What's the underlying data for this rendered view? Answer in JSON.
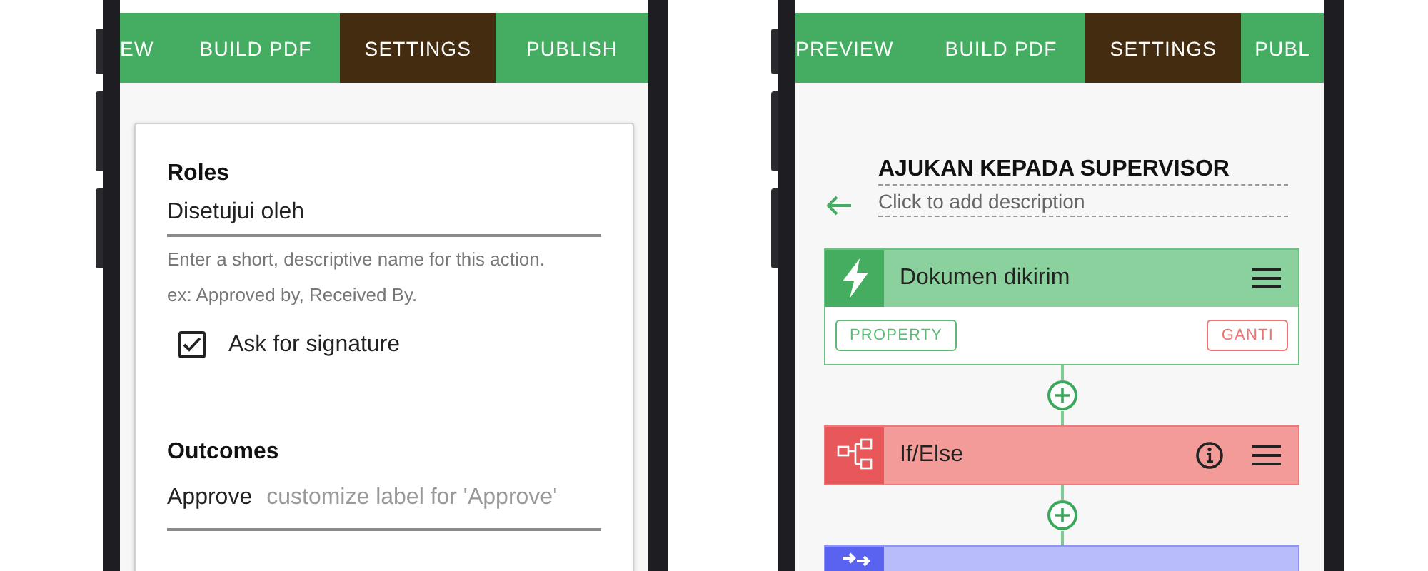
{
  "phones": [
    {
      "kind": "settings",
      "tabs": [
        {
          "label": "EW",
          "selected": false
        },
        {
          "label": "BUILD PDF",
          "selected": false
        },
        {
          "label": "SETTINGS",
          "selected": true
        },
        {
          "label": "PUBLISH",
          "selected": false
        }
      ],
      "roles": {
        "heading": "Roles",
        "value": "Disetujui oleh",
        "help": [
          "Enter a short, descriptive name for this action.",
          "ex: Approved by, Received By."
        ],
        "signature": {
          "label": "Ask for signature",
          "checked": true
        }
      },
      "outcomes": {
        "heading": "Outcomes",
        "items": [
          {
            "label": "Approve",
            "placeholder": "customize label for 'Approve'"
          }
        ]
      }
    },
    {
      "kind": "workflow",
      "tabs": [
        {
          "label": "PREVIEW",
          "selected": false
        },
        {
          "label": "BUILD PDF",
          "selected": false
        },
        {
          "label": "SETTINGS",
          "selected": true
        },
        {
          "label": "PUBL",
          "selected": false
        }
      ],
      "title": "AJUKAN KEPADA SUPERVISOR",
      "description": "Click to add description",
      "blocks": [
        {
          "kind": "trigger",
          "title": "Dokumen dikirim",
          "info": false,
          "buttons": [
            {
              "label": "PROPERTY",
              "kind": "neutral"
            },
            {
              "label": "GANTI",
              "kind": "danger"
            }
          ]
        },
        {
          "kind": "condition",
          "title": "If/Else",
          "info": true
        },
        {
          "kind": "action"
        }
      ]
    }
  ]
}
